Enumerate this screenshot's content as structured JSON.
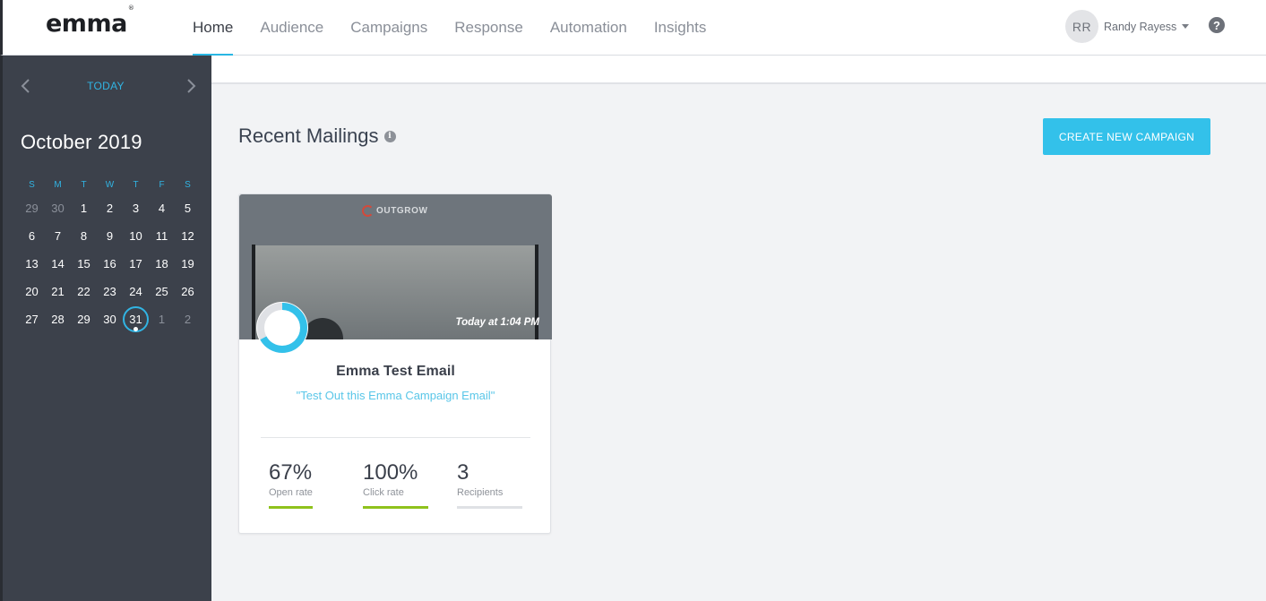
{
  "app": {
    "logo": "emma"
  },
  "nav": {
    "items": [
      {
        "label": "Home",
        "active": true
      },
      {
        "label": "Audience"
      },
      {
        "label": "Campaigns"
      },
      {
        "label": "Response"
      },
      {
        "label": "Automation"
      },
      {
        "label": "Insights"
      }
    ]
  },
  "user": {
    "initials": "RR",
    "name": "Randy Rayess"
  },
  "help": {
    "glyph": "?"
  },
  "calendar": {
    "today_label": "TODAY",
    "month": "October 2019",
    "weekdays": [
      "S",
      "M",
      "T",
      "W",
      "T",
      "F",
      "S"
    ],
    "weeks": [
      [
        "29",
        "30",
        "1",
        "2",
        "3",
        "4",
        "5"
      ],
      [
        "6",
        "7",
        "8",
        "9",
        "10",
        "11",
        "12"
      ],
      [
        "13",
        "14",
        "15",
        "16",
        "17",
        "18",
        "19"
      ],
      [
        "20",
        "21",
        "22",
        "23",
        "24",
        "25",
        "26"
      ],
      [
        "27",
        "28",
        "29",
        "30",
        "31",
        "1",
        "2"
      ]
    ],
    "muted": [
      [
        0,
        0
      ],
      [
        0,
        1
      ],
      [
        4,
        5
      ],
      [
        4,
        6
      ]
    ],
    "today": [
      4,
      4
    ]
  },
  "main": {
    "title": "Recent Mailings",
    "info_glyph": "i",
    "create_button": "CREATE NEW CAMPAIGN"
  },
  "mailing": {
    "brand": "OUTGROW",
    "timestamp": "Today at 1:04 PM",
    "name": "Emma Test Email",
    "subject": "\"Test Out this Emma Campaign Email\"",
    "progress": 0.67,
    "stats": [
      {
        "value": "67%",
        "label": "Open rate",
        "fill": 0.67
      },
      {
        "value": "100%",
        "label": "Click rate",
        "fill": 1.0
      },
      {
        "value": "3",
        "label": "Recipients",
        "fill": 0
      }
    ]
  },
  "colors": {
    "accent": "#29b6e3",
    "sidebar": "#3c414b",
    "stat_bar": "#8fc21d"
  }
}
